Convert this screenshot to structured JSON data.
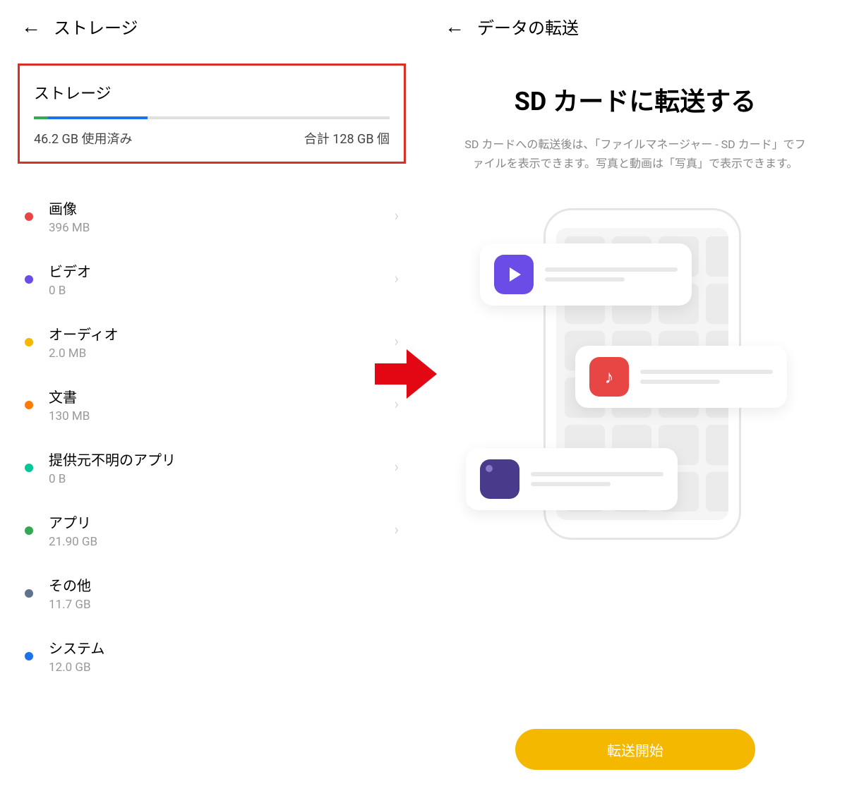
{
  "left": {
    "header_title": "ストレージ",
    "storage_card": {
      "title": "ストレージ",
      "used": "46.2 GB 使用済み",
      "total": "合計 128 GB 個"
    },
    "categories": [
      {
        "name": "画像",
        "size": "396 MB",
        "dot": "#e84545",
        "chevron": true
      },
      {
        "name": "ビデオ",
        "size": "0 B",
        "dot": "#6b4ce6",
        "chevron": true
      },
      {
        "name": "オーディオ",
        "size": "2.0 MB",
        "dot": "#f5b800",
        "chevron": true
      },
      {
        "name": "文書",
        "size": "130 MB",
        "dot": "#ff7b00",
        "chevron": true
      },
      {
        "name": "提供元不明のアプリ",
        "size": "0 B",
        "dot": "#00c896",
        "chevron": true
      },
      {
        "name": "アプリ",
        "size": "21.90 GB",
        "dot": "#34a853",
        "chevron": true
      },
      {
        "name": "その他",
        "size": "11.7 GB",
        "dot": "#5f738c",
        "chevron": false
      },
      {
        "name": "システム",
        "size": "12.0 GB",
        "dot": "#1a73e8",
        "chevron": false
      }
    ]
  },
  "right": {
    "header_title": "データの転送",
    "title": "SD カードに転送する",
    "description": "SD カードへの転送後は、「ファイルマネージャー - SD カード」でファイルを表示できます。写真と動画は「写真」で表示できます。",
    "button": "転送開始"
  }
}
